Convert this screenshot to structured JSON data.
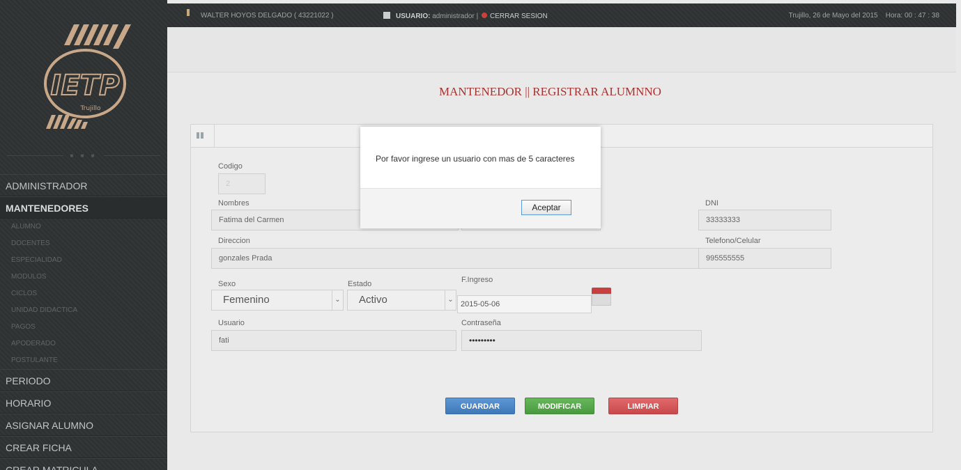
{
  "topbar": {
    "user": "WALTER HOYOS DELGADO ( 43221022 )",
    "usuario_label": "USUARIO:",
    "usuario_value": "administrador |",
    "logout": "CERRAR SESION",
    "datetime": "Trujillo, 26 de Mayo del 2015    Hora: 00 : 47 : 38"
  },
  "logo": {
    "letters": "IETP",
    "city": "Trujillo",
    "dots": "■ ■ ■"
  },
  "sidebar": {
    "items": [
      {
        "label": "ADMINISTRADOR"
      },
      {
        "label": "MANTENEDORES"
      },
      {
        "label": "PERIODO"
      },
      {
        "label": "HORARIO"
      },
      {
        "label": "ASIGNAR ALUMNO"
      },
      {
        "label": "CREAR FICHA"
      },
      {
        "label": "CREAR MATRICULA"
      }
    ],
    "subitems": [
      "ALUMNO",
      "DOCENTES",
      "ESPECIALIDAD",
      "MODULOS",
      "CICLOS",
      "UNIDAD DIDACTICA",
      "PAGOS",
      "APODERADO",
      "POSTULANTE"
    ]
  },
  "page": {
    "title": "MANTENEDOR || REGISTRAR ALUMNNO"
  },
  "form": {
    "codigo_label": "Codigo",
    "codigo_value": "2",
    "nombres_label": "Nombres",
    "nombres_value": "Fatima del Carmen",
    "dni_label": "DNI",
    "dni_value": "33333333",
    "direccion_label": "Direccion",
    "direccion_value": "gonzales Prada",
    "telefono_label": "Telefono/Celular",
    "telefono_value": "995555555",
    "sexo_label": "Sexo",
    "sexo_value": "Femenino",
    "estado_label": "Estado",
    "estado_value": "Activo",
    "fingreso_label": "F.Ingreso",
    "fingreso_value": "2015-05-06",
    "usuario_label": "Usuario",
    "usuario_value": "fati",
    "contrasena_label": "Contraseña",
    "contrasena_value": "•••••••••"
  },
  "buttons": {
    "guardar": "GUARDAR",
    "modificar": "MODIFICAR",
    "limpiar": "LIMPIAR"
  },
  "modal": {
    "message": "Por favor ingrese un usuario con mas de 5 caracteres",
    "accept": "Aceptar"
  },
  "colors": {
    "title_red": "#a8322f",
    "sidebar_bg": "#2f3233",
    "btn_blue": "#4a84c4",
    "btn_green": "#55a84a",
    "btn_red": "#d4575a"
  }
}
